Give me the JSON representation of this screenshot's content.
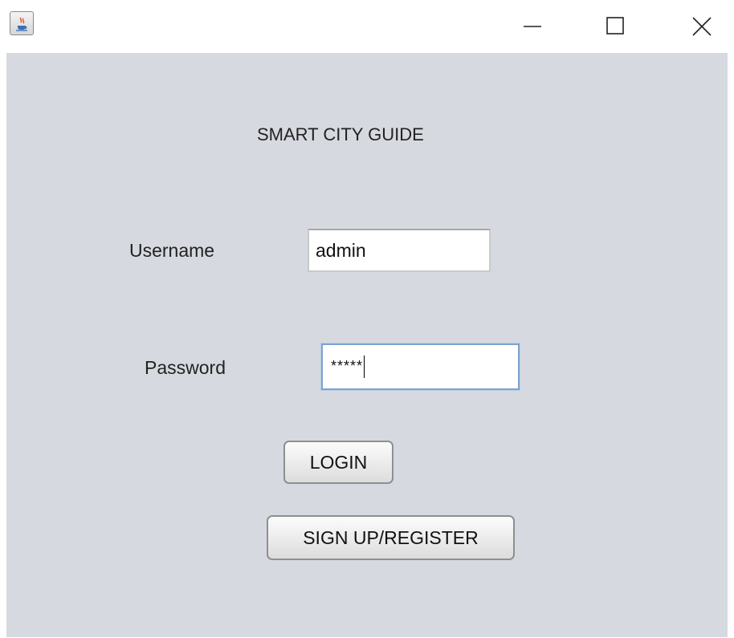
{
  "window": {
    "controls": {
      "minimize_icon": "minimize-icon",
      "maximize_icon": "maximize-icon",
      "close_icon": "close-icon"
    },
    "app_icon": "java-coffee-cup-icon"
  },
  "form": {
    "title": "SMART CITY GUIDE",
    "username_label": "Username",
    "username_value": "admin",
    "password_label": "Password",
    "password_masked": "*****",
    "login_label": "LOGIN",
    "signup_label": "SIGN UP/REGISTER"
  },
  "colors": {
    "panel_background": "#d7d9e0",
    "focus_border": "#7da2ce"
  }
}
